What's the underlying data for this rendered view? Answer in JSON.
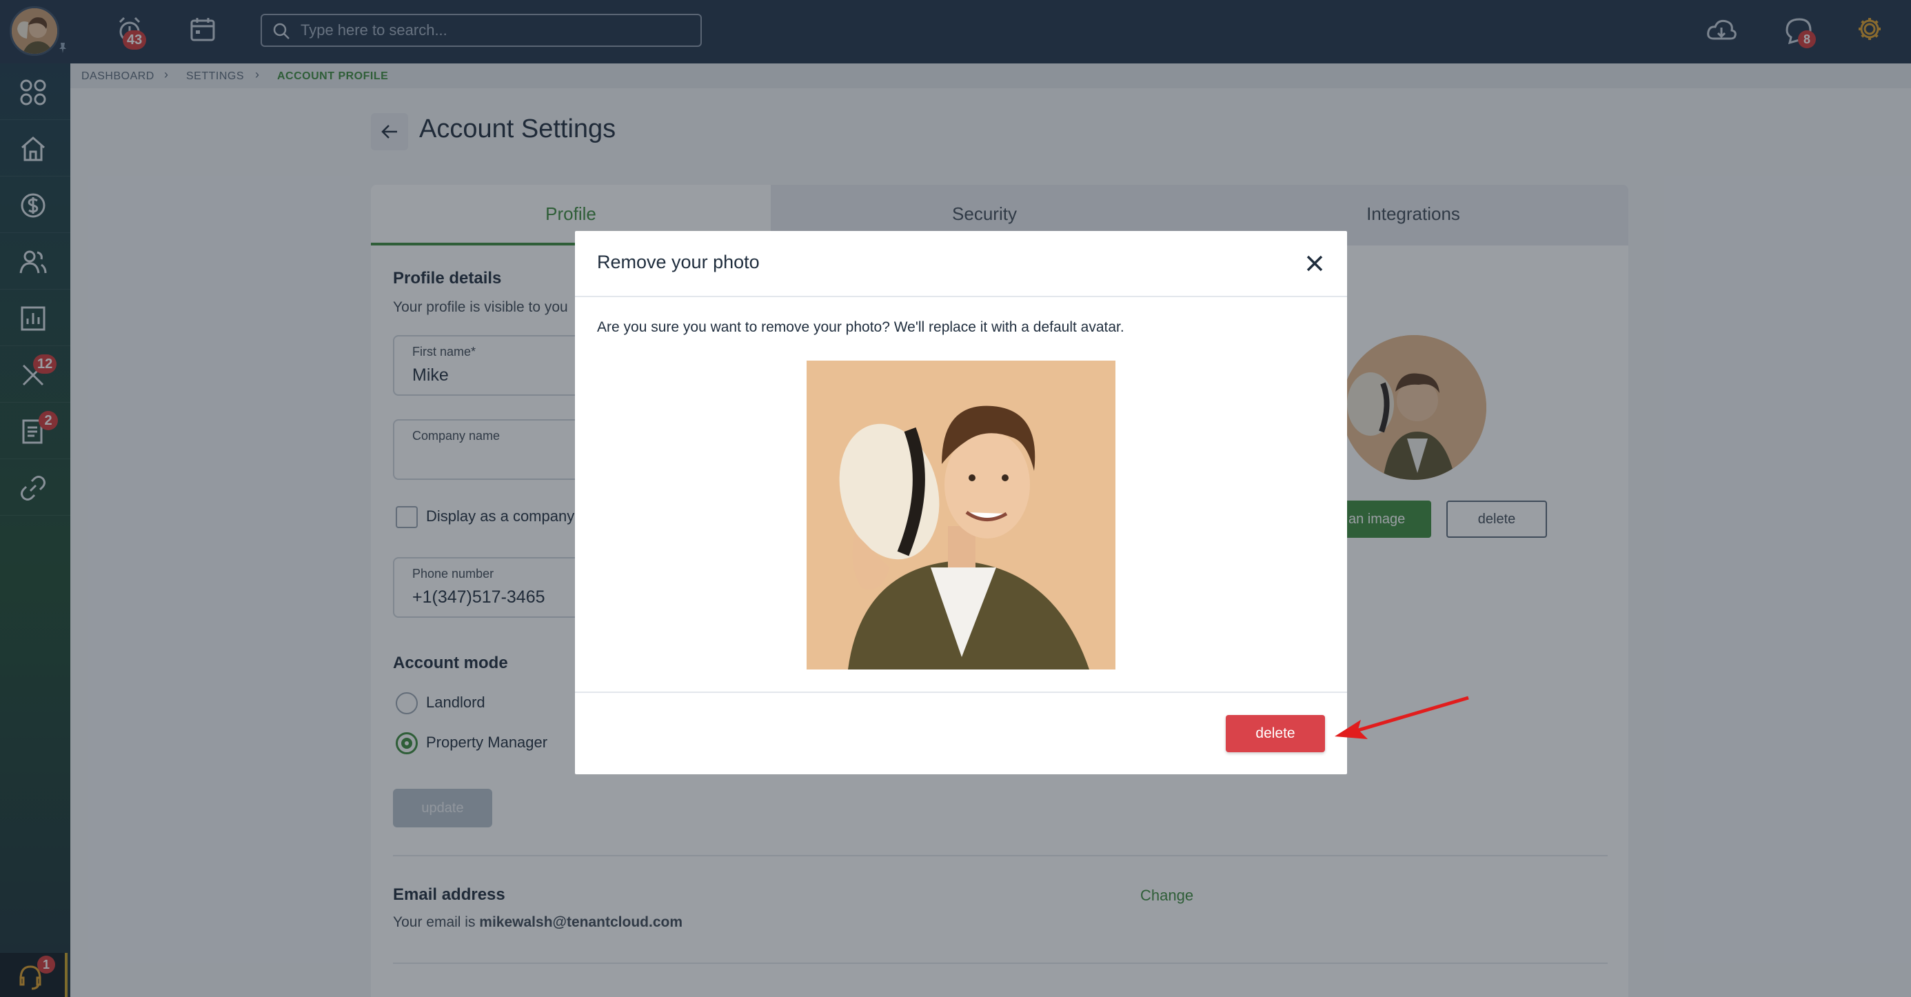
{
  "topbar": {
    "notifications_count": "43",
    "messages_count": "8",
    "search_placeholder": "Type here to search..."
  },
  "sidebar": {
    "maintenance_badge": "12",
    "documents_badge": "2",
    "support_badge": "1"
  },
  "breadcrumb": {
    "items": [
      "DASHBOARD",
      "SETTINGS",
      "ACCOUNT PROFILE"
    ]
  },
  "page": {
    "title": "Account Settings"
  },
  "tabs": [
    {
      "label": "Profile",
      "active": true
    },
    {
      "label": "Security",
      "active": false
    },
    {
      "label": "Integrations",
      "active": false
    }
  ],
  "profile": {
    "section_title": "Profile details",
    "section_sub": "Your profile is visible to you",
    "first_name_label": "First name*",
    "first_name_value": "Mike",
    "company_label": "Company name",
    "company_value": "",
    "display_company_label": "Display as a company",
    "phone_label": "Phone number",
    "phone_value": "+1(347)517-3465",
    "account_mode_title": "Account mode",
    "mode_landlord": "Landlord",
    "mode_pm": "Property Manager",
    "update_label": "update",
    "upload_label": "an image",
    "delete_label": "delete"
  },
  "email": {
    "title": "Email address",
    "prefix": "Your email is ",
    "address": "mikewalsh@tenantcloud.com",
    "change_label": "Change"
  },
  "modal": {
    "title": "Remove your photo",
    "message": "Are you sure you want to remove your photo? We'll replace it with a default avatar.",
    "delete_label": "delete"
  },
  "colors": {
    "accent": "#3d8b3d",
    "danger": "#d9434a",
    "topbar": "#22344a",
    "badge": "#d23a3a"
  }
}
